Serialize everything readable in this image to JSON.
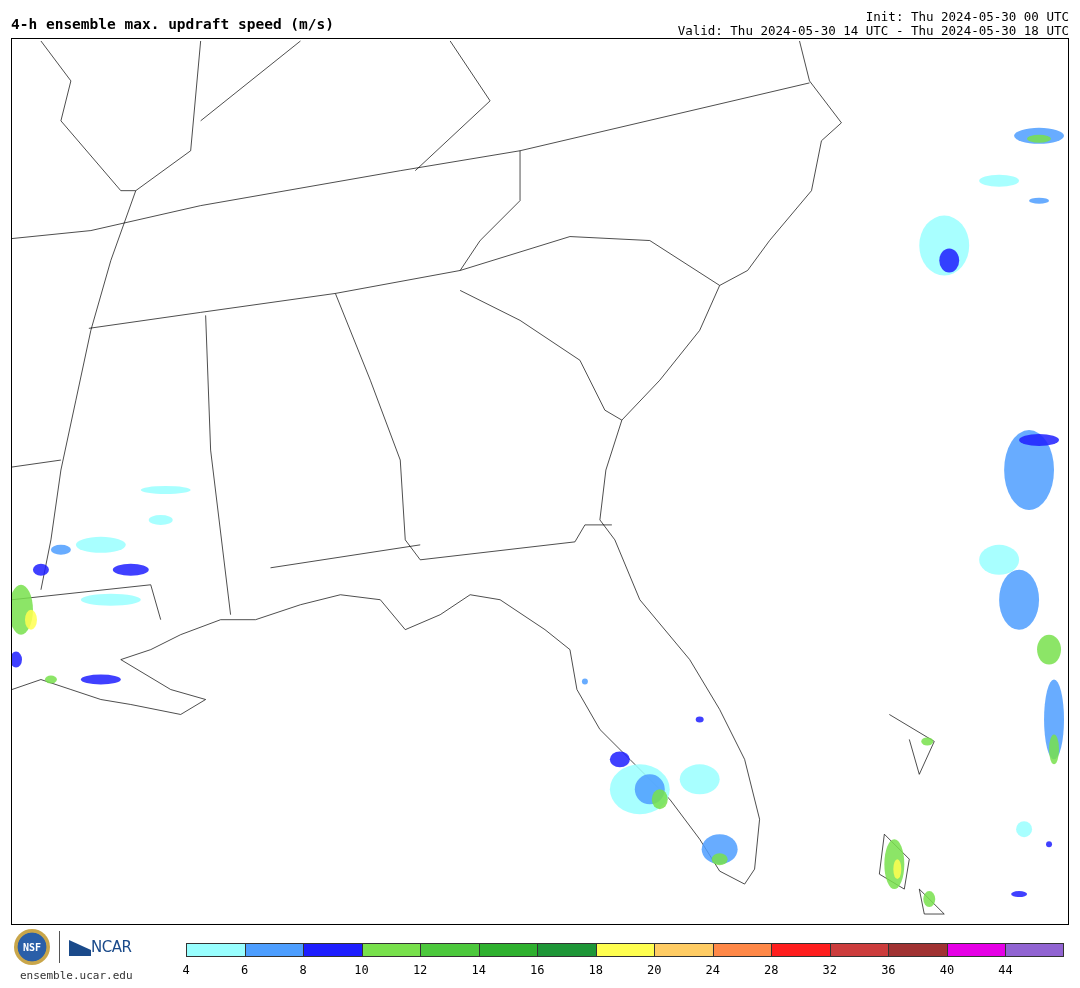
{
  "header": {
    "title": "4-h ensemble max. updraft speed (m/s)",
    "init": "Init: Thu 2024-05-30 00 UTC",
    "valid": "Valid: Thu 2024-05-30 14 UTC - Thu 2024-05-30 18 UTC"
  },
  "footer": {
    "logo_nsf": "NSF",
    "logo_ncar": "NCAR",
    "url": "ensemble.ucar.edu"
  },
  "colorbar": {
    "bins": [
      {
        "color": "#99ffff",
        "label": "4"
      },
      {
        "color": "#4d9eff",
        "label": "6"
      },
      {
        "color": "#1e1eff",
        "label": "8"
      },
      {
        "color": "#78e04c",
        "label": "10"
      },
      {
        "color": "#4cc83c",
        "label": "12"
      },
      {
        "color": "#2fb02f",
        "label": "14"
      },
      {
        "color": "#1e9637",
        "label": "16"
      },
      {
        "color": "#ffff50",
        "label": "18"
      },
      {
        "color": "#ffcc64",
        "label": "20"
      },
      {
        "color": "#ff8848",
        "label": "24"
      },
      {
        "color": "#ff1e1e",
        "label": "28"
      },
      {
        "color": "#cc3c3c",
        "label": "32"
      },
      {
        "color": "#a03232",
        "label": "36"
      },
      {
        "color": "#e600e6",
        "label": "40"
      },
      {
        "color": "#9164d2",
        "label": "44"
      }
    ]
  }
}
